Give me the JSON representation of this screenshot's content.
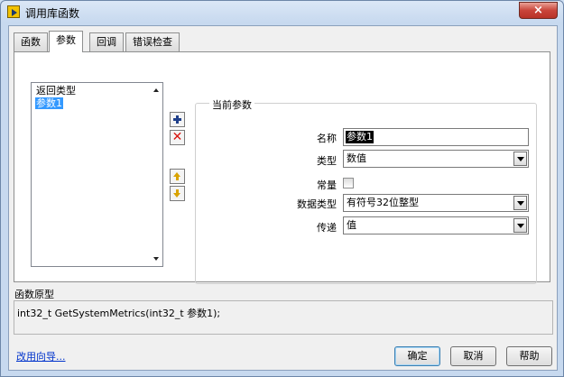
{
  "window": {
    "title": "调用库函数",
    "close_glyph": "×"
  },
  "tabs": [
    {
      "label": "函数"
    },
    {
      "label": "参数"
    },
    {
      "label": "回调"
    },
    {
      "label": "错误检查"
    }
  ],
  "params_list": {
    "items": [
      {
        "label": "返回类型",
        "selected": false
      },
      {
        "label": "参数1",
        "selected": true
      }
    ]
  },
  "current_param": {
    "group_title": "当前参数",
    "name_label": "名称",
    "name_value": "参数1",
    "type_label": "类型",
    "type_value": "数值",
    "const_label": "常量",
    "const_checked": false,
    "datatype_label": "数据类型",
    "datatype_value": "有符号32位整型",
    "pass_label": "传递",
    "pass_value": "值"
  },
  "prototype": {
    "label": "函数原型",
    "text": "int32_t GetSystemMetrics(int32_t 参数1);"
  },
  "footer": {
    "wizard_link": "改用向导...",
    "ok_label": "确定",
    "cancel_label": "取消",
    "help_label": "帮助"
  },
  "colors": {
    "selection": "#3399ff",
    "close_button": "#c9453a",
    "link": "#0033cc"
  }
}
